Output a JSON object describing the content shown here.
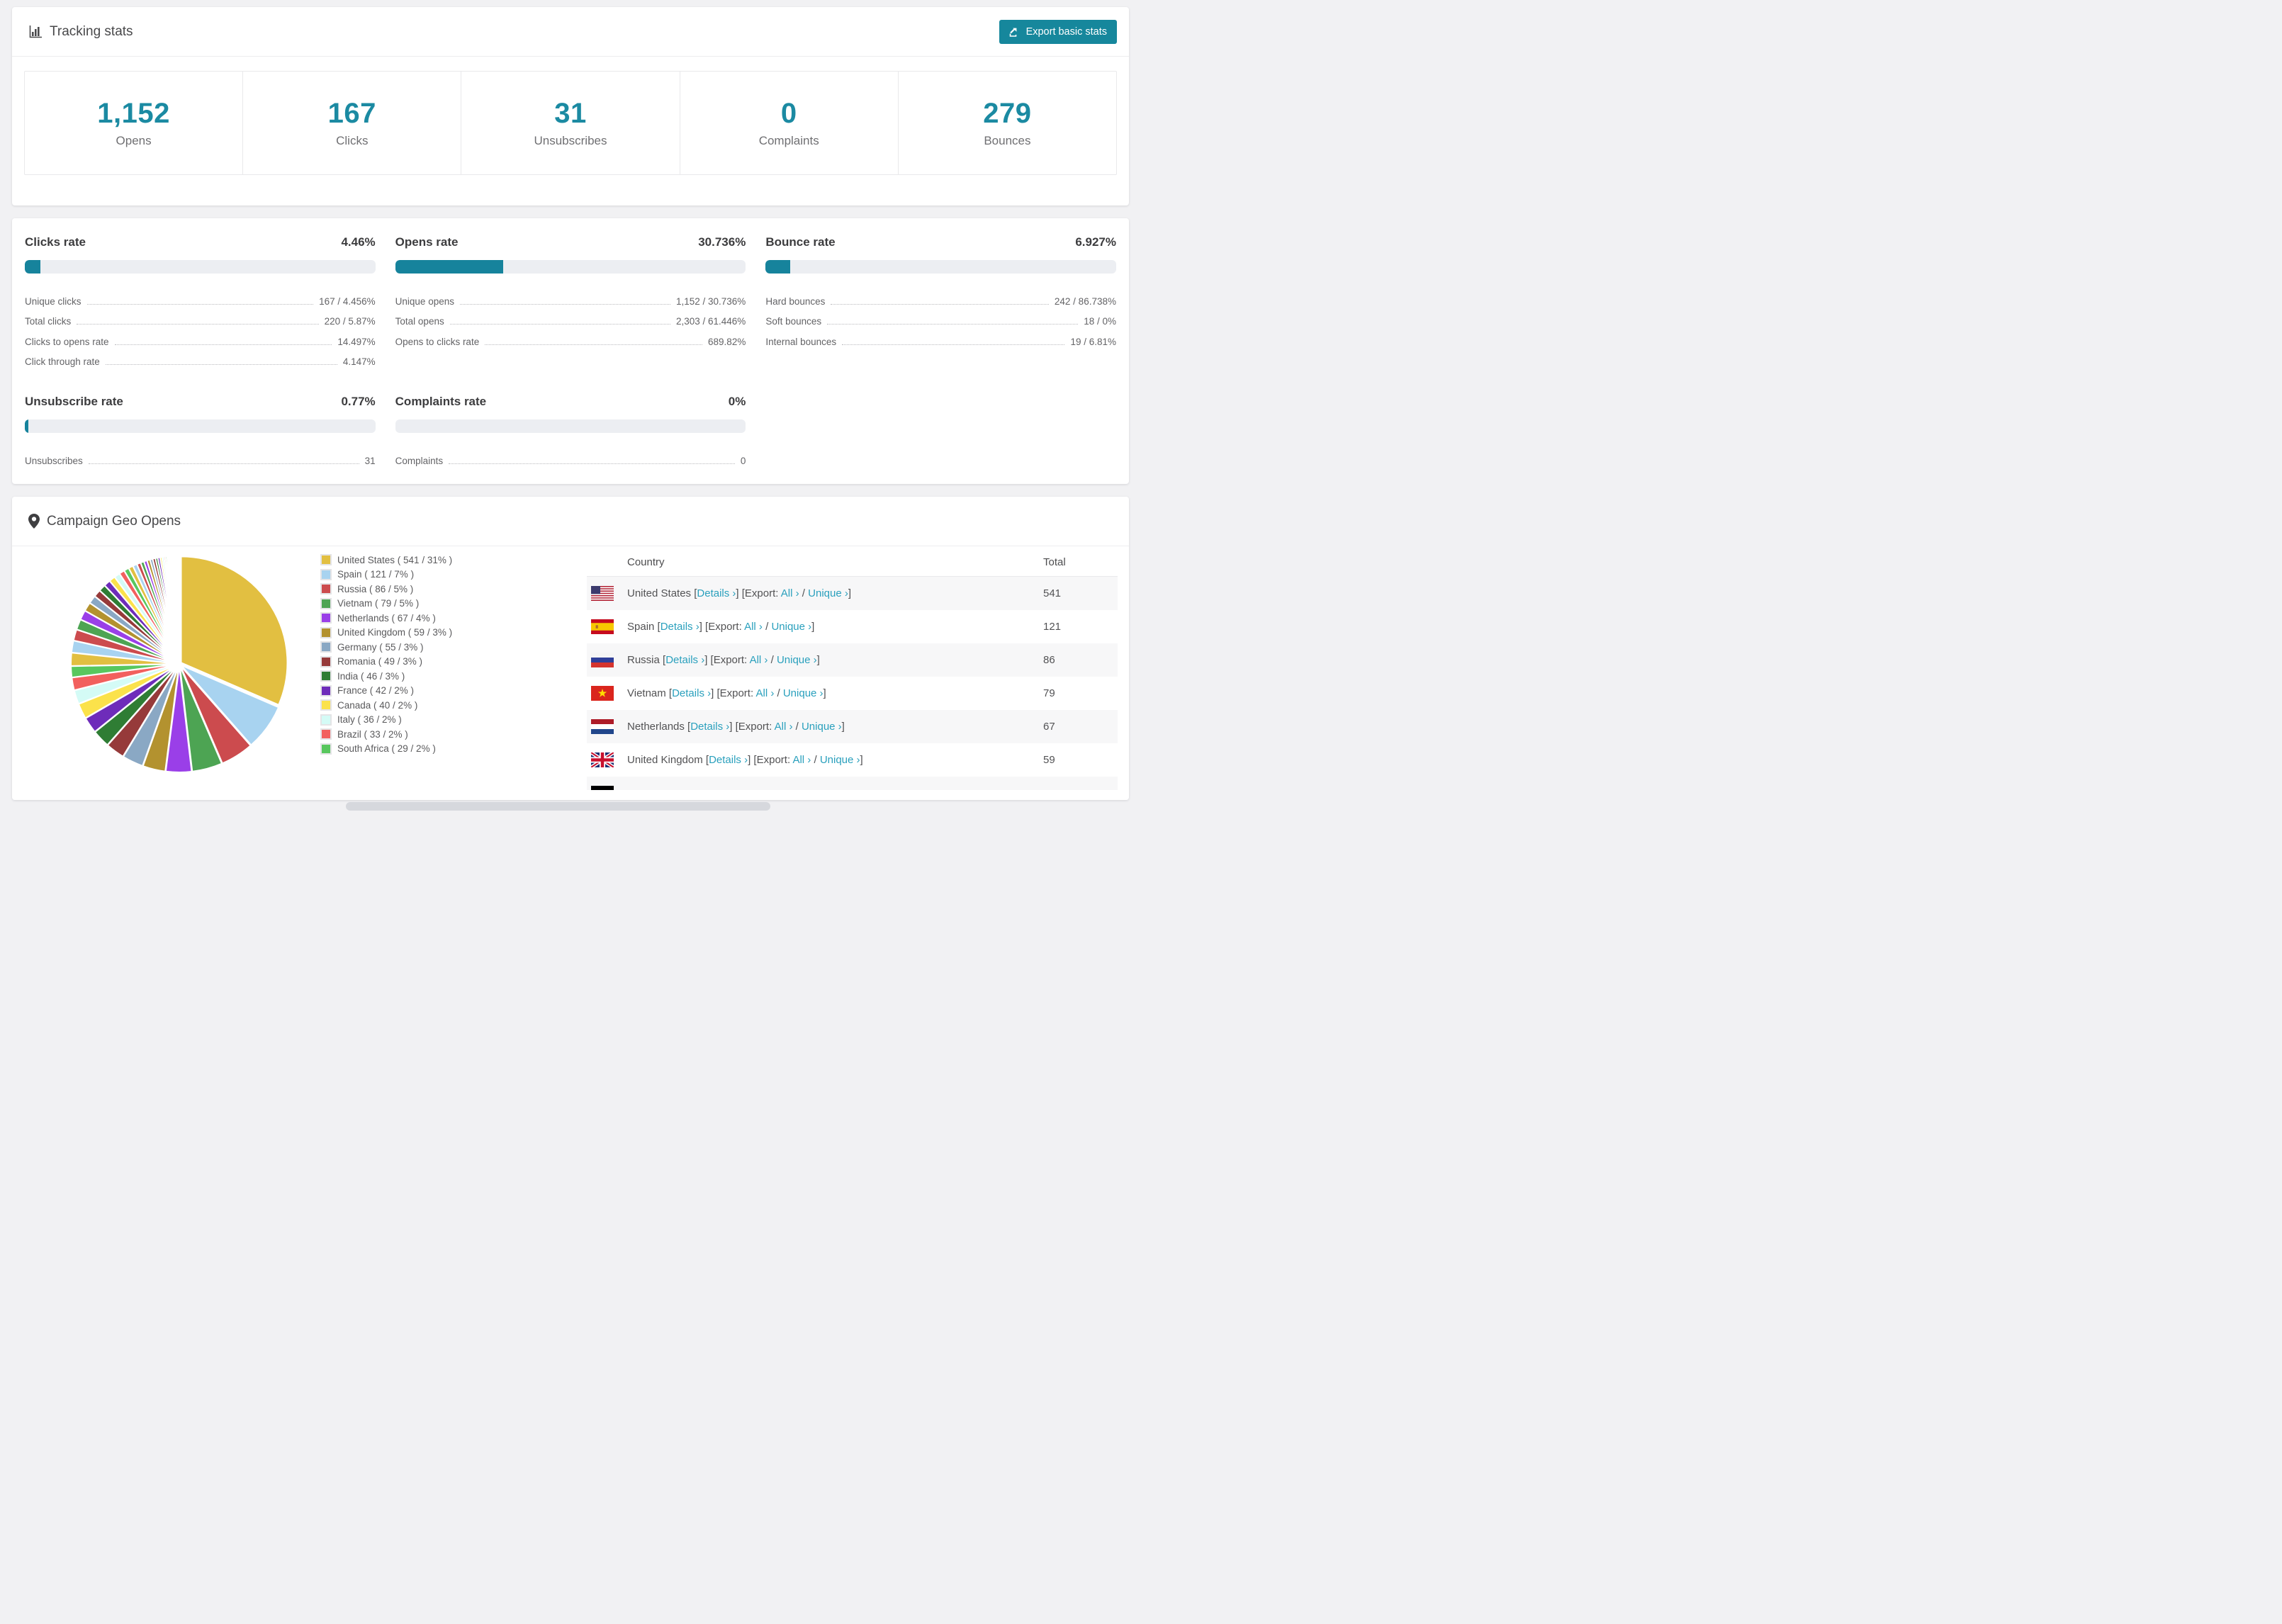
{
  "colors": {
    "accent_teal": "#16879c",
    "stat_number_teal": "#1b8aa2",
    "link_teal": "#2aa0bd",
    "bar_track": "#eceef2",
    "page_background": "#f1f1f3"
  },
  "tracking": {
    "title": "Tracking stats",
    "export_label": "Export basic stats",
    "stats": [
      {
        "key": "opens",
        "value": "1,152",
        "label": "Opens"
      },
      {
        "key": "clicks",
        "value": "167",
        "label": "Clicks"
      },
      {
        "key": "unsubscribes",
        "value": "31",
        "label": "Unsubscribes"
      },
      {
        "key": "complaints",
        "value": "0",
        "label": "Complaints"
      },
      {
        "key": "bounces",
        "value": "279",
        "label": "Bounces"
      }
    ]
  },
  "rates": {
    "blocks": [
      {
        "key": "clicks-rate",
        "title": "Clicks rate",
        "pct_label": "4.46%",
        "bar_pct": 4.46,
        "rows": [
          {
            "label": "Unique clicks",
            "value": "167 / 4.456%"
          },
          {
            "label": "Total clicks",
            "value": "220 / 5.87%"
          },
          {
            "label": "Clicks to opens rate",
            "value": "14.497%"
          },
          {
            "label": "Click through rate",
            "value": "4.147%"
          }
        ]
      },
      {
        "key": "opens-rate",
        "title": "Opens rate",
        "pct_label": "30.736%",
        "bar_pct": 30.736,
        "rows": [
          {
            "label": "Unique opens",
            "value": "1,152 / 30.736%"
          },
          {
            "label": "Total opens",
            "value": "2,303 / 61.446%"
          },
          {
            "label": "Opens to clicks rate",
            "value": "689.82%"
          }
        ]
      },
      {
        "key": "bounce-rate",
        "title": "Bounce rate",
        "pct_label": "6.927%",
        "bar_pct": 6.927,
        "rows": [
          {
            "label": "Hard bounces",
            "value": "242 / 86.738%"
          },
          {
            "label": "Soft bounces",
            "value": "18 / 0%"
          },
          {
            "label": "Internal bounces",
            "value": "19 / 6.81%"
          }
        ]
      },
      {
        "key": "unsubscribe-rate",
        "title": "Unsubscribe rate",
        "pct_label": "0.77%",
        "bar_pct": 0.77,
        "rows": [
          {
            "label": "Unsubscribes",
            "value": "31"
          }
        ]
      },
      {
        "key": "complaints-rate",
        "title": "Complaints rate",
        "pct_label": "0%",
        "bar_pct": 0,
        "rows": [
          {
            "label": "Complaints",
            "value": "0"
          }
        ]
      }
    ]
  },
  "geo": {
    "title": "Campaign Geo Opens",
    "table": {
      "columns": [
        "Country",
        "Total"
      ],
      "links": {
        "pre": "[",
        "details": "Details ›",
        "post_details": "] [Export: ",
        "all": "All ›",
        "mid": " / ",
        "unique": "Unique ›",
        "end": "]"
      },
      "rows": [
        {
          "country": "United States",
          "flag": "us",
          "total": "541",
          "partial": false
        },
        {
          "country": "Spain",
          "flag": "es",
          "total": "121",
          "partial": false
        },
        {
          "country": "Russia",
          "flag": "ru",
          "total": "86",
          "partial": false
        },
        {
          "country": "Vietnam",
          "flag": "vn",
          "total": "79",
          "partial": false
        },
        {
          "country": "Netherlands",
          "flag": "nl",
          "total": "67",
          "partial": false
        },
        {
          "country": "United Kingdom",
          "flag": "gb",
          "total": "59",
          "partial": false
        },
        {
          "country": "",
          "flag": "de",
          "total": "",
          "partial": true
        }
      ]
    }
  },
  "chart_data": {
    "type": "pie",
    "title": "Campaign Geo Opens",
    "legend_position": "right",
    "start_angle_deg": -90,
    "direction": "clockwise",
    "series": [
      {
        "name": "United States",
        "value": 541,
        "pct": 31
      },
      {
        "name": "Spain",
        "value": 121,
        "pct": 7
      },
      {
        "name": "Russia",
        "value": 86,
        "pct": 5
      },
      {
        "name": "Vietnam",
        "value": 79,
        "pct": 5
      },
      {
        "name": "Netherlands",
        "value": 67,
        "pct": 4
      },
      {
        "name": "United Kingdom",
        "value": 59,
        "pct": 3
      },
      {
        "name": "Germany",
        "value": 55,
        "pct": 3
      },
      {
        "name": "Romania",
        "value": 49,
        "pct": 3
      },
      {
        "name": "India",
        "value": 46,
        "pct": 3
      },
      {
        "name": "France",
        "value": 42,
        "pct": 2
      },
      {
        "name": "Canada",
        "value": 40,
        "pct": 2
      },
      {
        "name": "Italy",
        "value": 36,
        "pct": 2
      },
      {
        "name": "Brazil",
        "value": 33,
        "pct": 2
      },
      {
        "name": "South Africa",
        "value": 29,
        "pct": 2
      }
    ],
    "others_estimated": {
      "note": "long tail of small unlabeled slices, values estimated from slice widths",
      "values": [
        34,
        31,
        29,
        27,
        25,
        23,
        21,
        19,
        18,
        17,
        16,
        15,
        14,
        13,
        12,
        11,
        10,
        9,
        8,
        8,
        7,
        7,
        6,
        6,
        5,
        5,
        4,
        4,
        3,
        3,
        3,
        2,
        2,
        2,
        2,
        2,
        1,
        1,
        1,
        1,
        1,
        1,
        1,
        1,
        1,
        1,
        1,
        1
      ]
    },
    "palette": [
      "#e2bf41",
      "#a8d3f0",
      "#cc4b4e",
      "#4da453",
      "#9a3fe8",
      "#b3922f",
      "#8aa8c4",
      "#963a3a",
      "#2f7d34",
      "#6e2cba",
      "#fbe24b",
      "#d4fbf6",
      "#f2605e",
      "#58c75e"
    ]
  }
}
